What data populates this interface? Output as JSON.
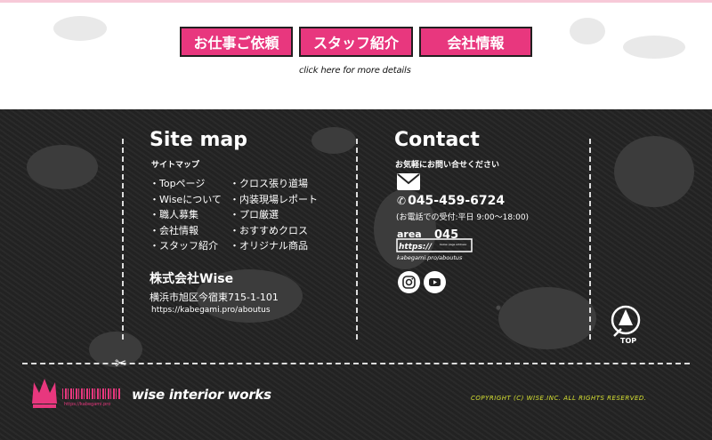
{
  "nav_buttons": [
    {
      "label": "お仕事ご依頼"
    },
    {
      "label": "スタッフ紹介"
    },
    {
      "label": "会社情報"
    }
  ],
  "more_details": "click here for more details",
  "sitemap": {
    "title": "Site map",
    "subtitle": "サイトマップ",
    "col1": [
      "・Topページ",
      "・Wiseについて",
      "・職人募集",
      "・会社情報",
      "・スタッフ紹介"
    ],
    "col2": [
      "・クロス張り道場",
      "・内装現場レポート",
      "・プロ厳選",
      "・おすすめクロス",
      "・オリジナル商品"
    ]
  },
  "company": {
    "name": "株式会社Wise",
    "address": "横浜市旭区今宿東715-1-101",
    "url": "https://kabegami.pro/aboutus"
  },
  "contact": {
    "title": "Contact",
    "subtitle": "お気軽にお問い合せください",
    "phone": "045-459-6724",
    "hours": "(お電話での受付:平日 9:00〜18:00)"
  },
  "area_logo": {
    "line1": "area",
    "num": "045",
    "line2": "https://",
    "line3": "kabegami.pro/aboutus",
    "tag": "below page address"
  },
  "top_label": "TOP",
  "footer": {
    "barcode_url": "https://kabegami.pro",
    "brand": "wise interior works",
    "copyright": "COPYRIGHT (C) WISE.INC. ALL RIGHTS RESERVED."
  },
  "colors": {
    "accent_pink": "#e8377e",
    "dark_bg": "#232323",
    "copyright_yellow": "#d7e232"
  }
}
